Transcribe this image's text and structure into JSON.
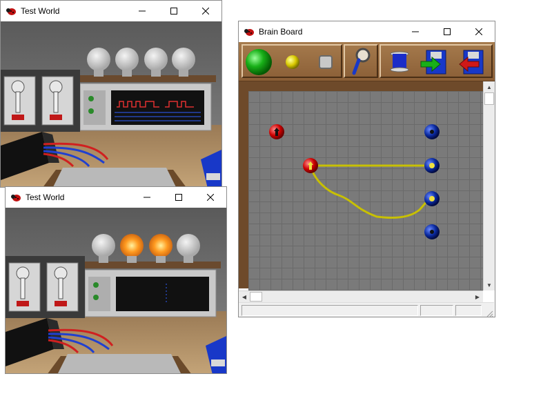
{
  "windows": {
    "test_world_1": {
      "title": "Test World"
    },
    "test_world_2": {
      "title": "Test World"
    },
    "brain_board": {
      "title": "Brain Board"
    }
  },
  "toolbar": {
    "items": [
      {
        "icon": "green-ball-icon"
      },
      {
        "icon": "yellow-ball-icon"
      },
      {
        "icon": "gray-square-icon"
      },
      {
        "icon": "magnifier-icon"
      },
      {
        "icon": "blue-spool-icon"
      },
      {
        "icon": "save-green-arrow-icon"
      },
      {
        "icon": "load-red-arrow-icon"
      }
    ]
  },
  "colors": {
    "board_brown": "#8a5e36",
    "grid_gray": "#7a7a7a",
    "wire_yellow": "#c8c000",
    "node_red": "#cc0000",
    "node_blue": "#0a2aa0"
  }
}
